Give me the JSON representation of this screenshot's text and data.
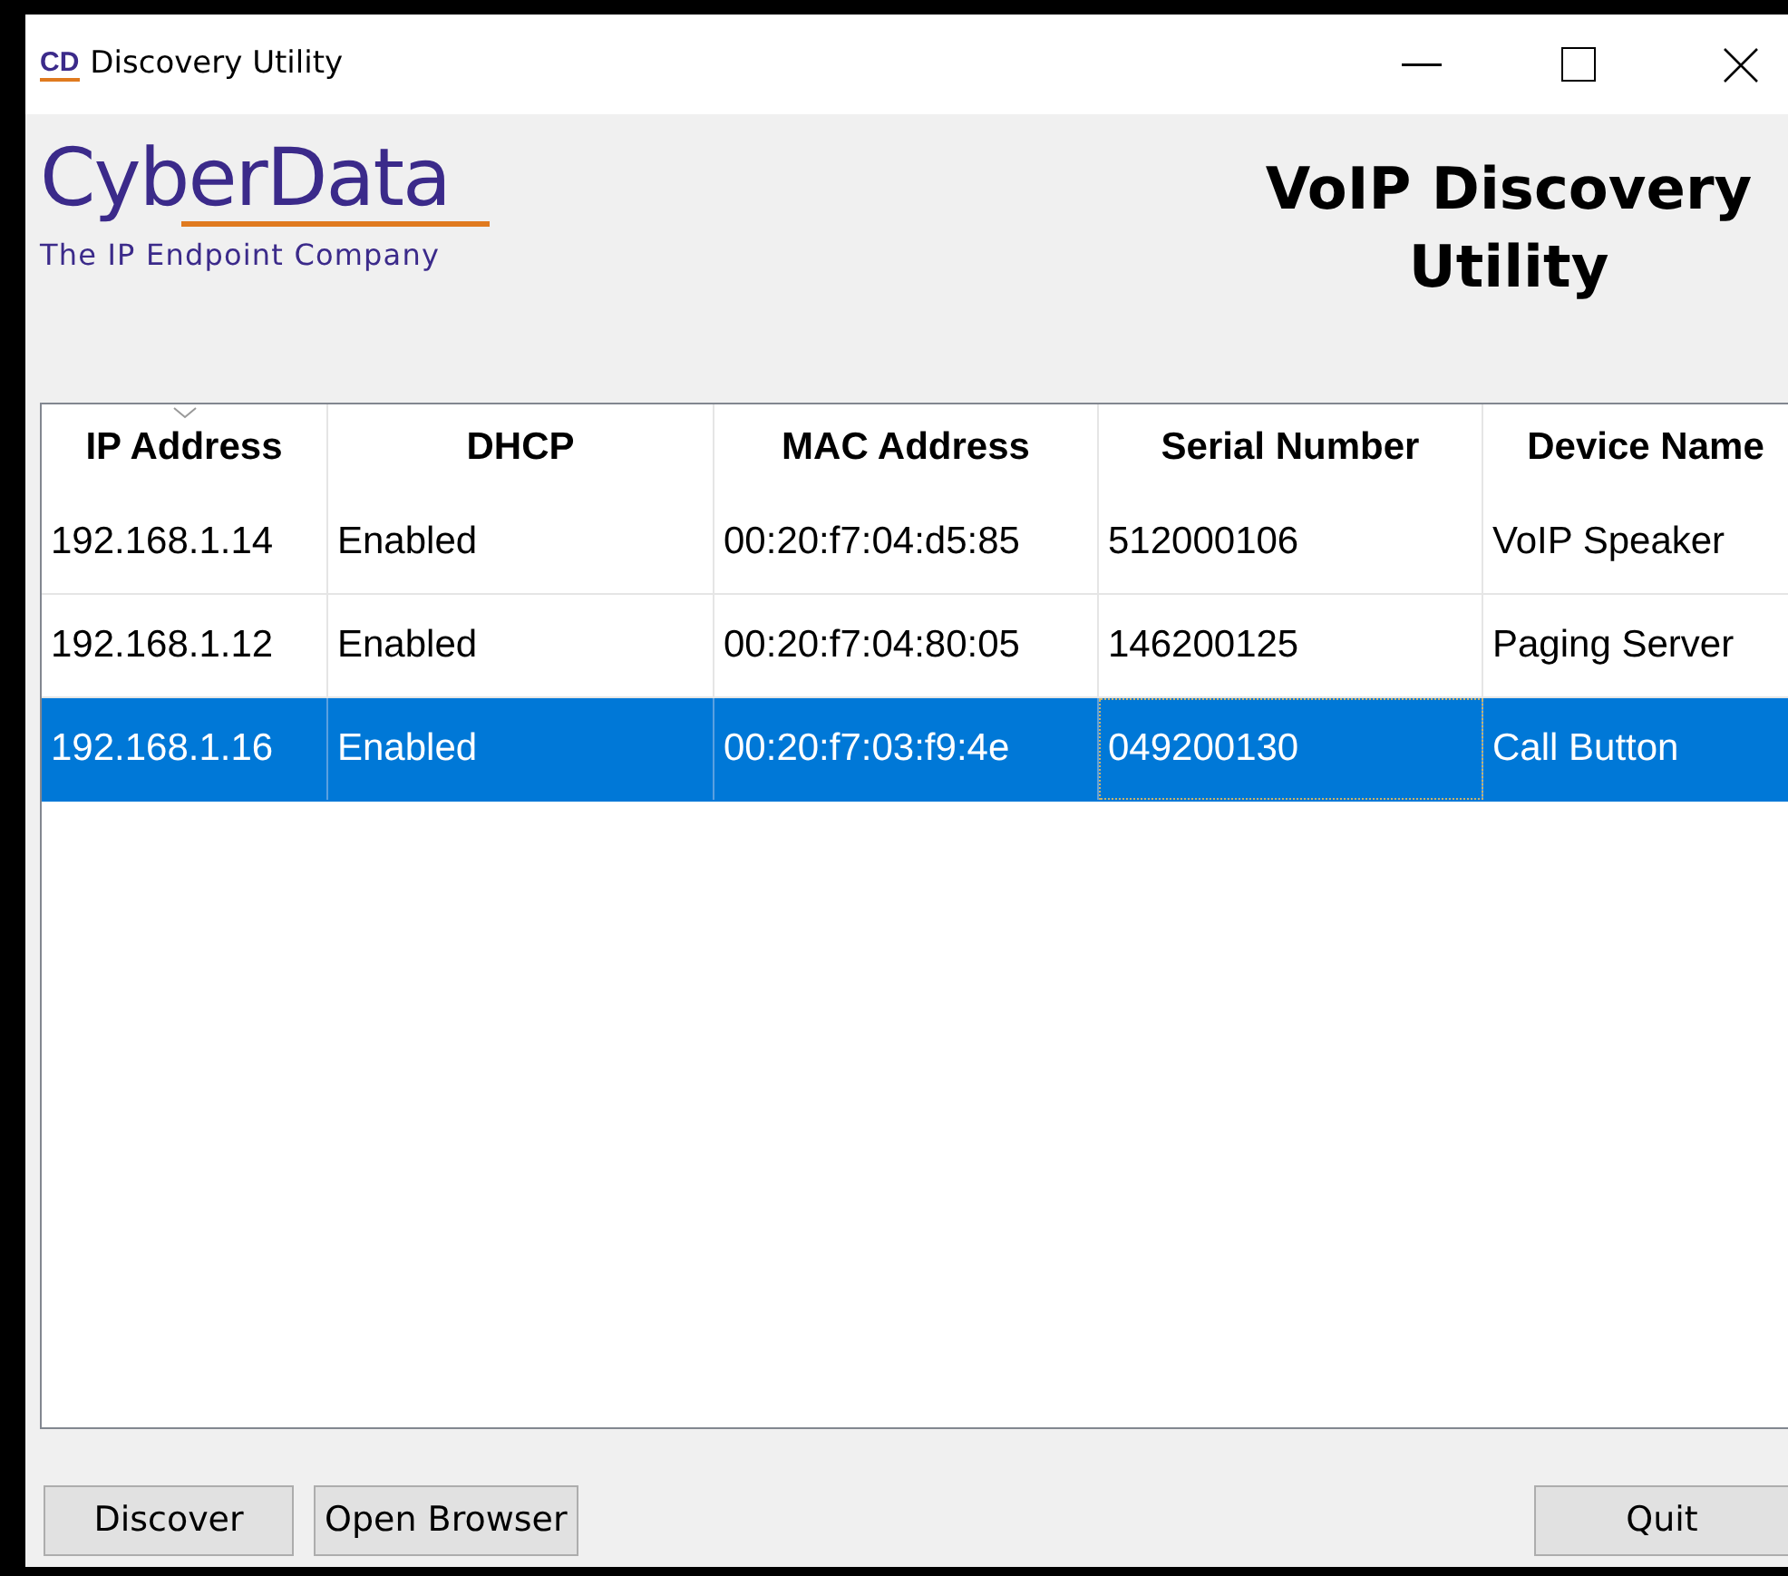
{
  "window": {
    "app_icon": "CD",
    "title": "Discovery Utility"
  },
  "logo": {
    "name": "CyberData",
    "tagline": "The IP Endpoint Company"
  },
  "heading": "VoIP Discovery Utility",
  "table": {
    "columns": [
      {
        "label": "IP Address",
        "sorted": true
      },
      {
        "label": "DHCP",
        "sorted": false
      },
      {
        "label": "MAC Address",
        "sorted": false
      },
      {
        "label": "Serial Number",
        "sorted": false
      },
      {
        "label": "Device Name",
        "sorted": false
      }
    ],
    "rows": [
      {
        "selected": false,
        "cells": [
          {
            "text": "192.168.1.14",
            "focused": false
          },
          {
            "text": "Enabled",
            "focused": false
          },
          {
            "text": "00:20:f7:04:d5:85",
            "focused": false
          },
          {
            "text": "512000106",
            "focused": false
          },
          {
            "text": "VoIP Speaker",
            "focused": false
          }
        ]
      },
      {
        "selected": false,
        "cells": [
          {
            "text": "192.168.1.12",
            "focused": false
          },
          {
            "text": "Enabled",
            "focused": false
          },
          {
            "text": "00:20:f7:04:80:05",
            "focused": false
          },
          {
            "text": "146200125",
            "focused": false
          },
          {
            "text": "Paging Server",
            "focused": false
          }
        ]
      },
      {
        "selected": true,
        "cells": [
          {
            "text": "192.168.1.16",
            "focused": false
          },
          {
            "text": "Enabled",
            "focused": false
          },
          {
            "text": "00:20:f7:03:f9:4e",
            "focused": false
          },
          {
            "text": "049200130",
            "focused": true
          },
          {
            "text": "Call Button",
            "focused": false
          }
        ]
      }
    ]
  },
  "buttons": {
    "left": [
      "Discover",
      "Open Browser"
    ],
    "right": [
      "Quit"
    ]
  }
}
